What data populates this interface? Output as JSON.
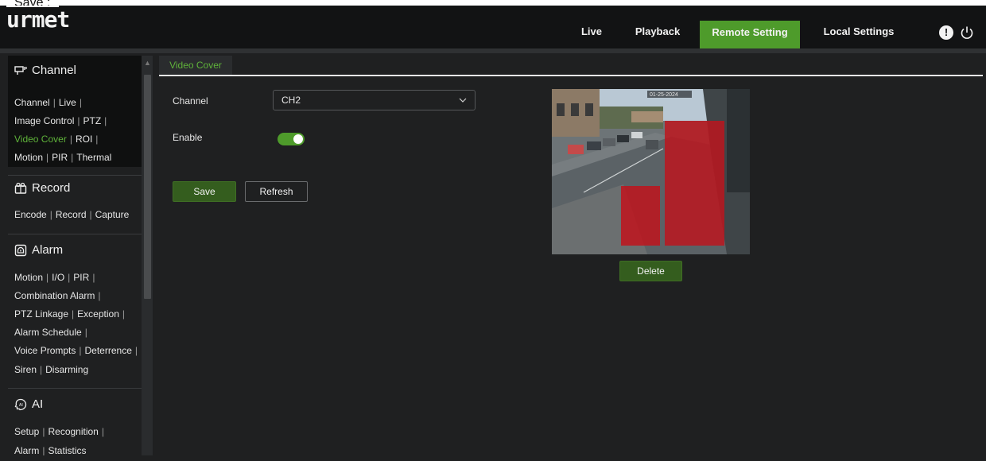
{
  "overlay_caption": "Save :",
  "brand": {
    "logo_text": "urmet"
  },
  "nav": {
    "items": [
      {
        "label": "Live",
        "active": false
      },
      {
        "label": "Playback",
        "active": false
      },
      {
        "label": "Remote Setting",
        "active": true
      },
      {
        "label": "Local Settings",
        "active": false
      }
    ],
    "info_icon": "info-icon",
    "power_icon": "power-icon"
  },
  "sidebar": {
    "channel": {
      "title": "Channel",
      "icon": "camera-icon",
      "lines": [
        [
          "Channel",
          "Live"
        ],
        [
          "Image Control",
          "PTZ"
        ],
        [
          "Video Cover",
          "ROI"
        ],
        [
          "Motion",
          "PIR",
          "Thermal"
        ]
      ],
      "active_item": "Video Cover"
    },
    "record": {
      "title": "Record",
      "icon": "record-icon",
      "lines": [
        [
          "Encode",
          "Record",
          "Capture"
        ]
      ]
    },
    "alarm": {
      "title": "Alarm",
      "icon": "alarm-icon",
      "lines": [
        [
          "Motion",
          "I/O",
          "PIR"
        ],
        [
          "Combination Alarm"
        ],
        [
          "PTZ Linkage",
          "Exception"
        ],
        [
          "Alarm Schedule"
        ],
        [
          "Voice Prompts",
          "Deterrence"
        ],
        [
          "Siren",
          "Disarming"
        ]
      ]
    },
    "ai": {
      "title": "AI",
      "icon": "ai-icon",
      "lines": [
        [
          "Setup",
          "Recognition"
        ],
        [
          "Alarm",
          "Statistics"
        ]
      ]
    }
  },
  "main": {
    "tab_label": "Video Cover",
    "channel_label": "Channel",
    "channel_value": "CH2",
    "enable_label": "Enable",
    "enable_on": true,
    "save_label": "Save",
    "refresh_label": "Refresh",
    "delete_label": "Delete",
    "preview_timestamp": "01-25-2024"
  },
  "colors": {
    "accent": "#4e9b2b",
    "active_text": "#5fb33a",
    "background": "#1f2021",
    "topbar": "#121314",
    "mask": "#c0141c"
  }
}
